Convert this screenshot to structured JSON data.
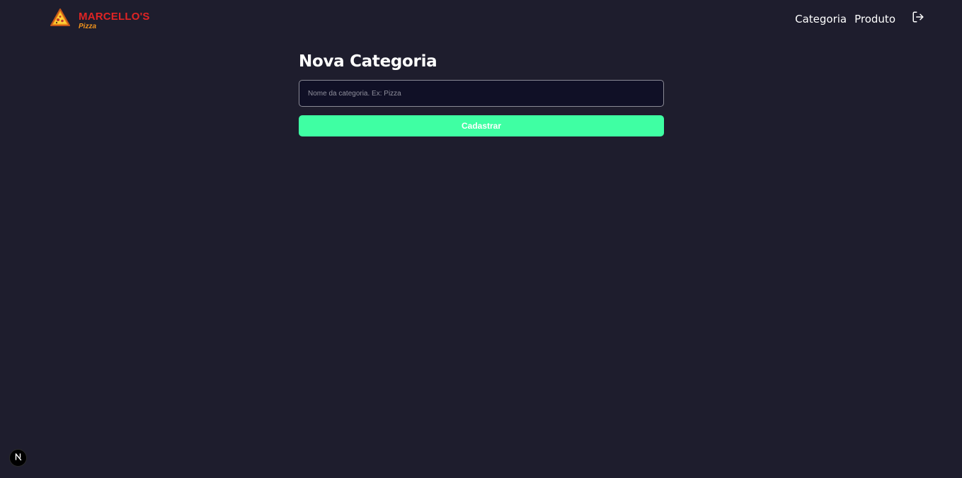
{
  "header": {
    "logo": {
      "brand": "MARCELLO'S",
      "sub": "Pizza",
      "icon": "pizza-slice-icon",
      "brand_color": "#e02424",
      "sub_color": "#f2941c"
    },
    "nav": {
      "links": [
        "Categoria",
        "Produto"
      ],
      "logout_icon": "log-out-icon"
    }
  },
  "main": {
    "title": "Nova Categoria",
    "input": {
      "placeholder": "Nome da categoria. Ex: Pizza",
      "value": ""
    },
    "submit_label": "Cadastrar"
  },
  "dev_badge": {
    "letter": "N",
    "icon": "nextjs-icon"
  },
  "colors": {
    "background": "#1e1d2d",
    "input_background": "#101026",
    "accent": "#3fffa3",
    "text": "#ffffff"
  }
}
